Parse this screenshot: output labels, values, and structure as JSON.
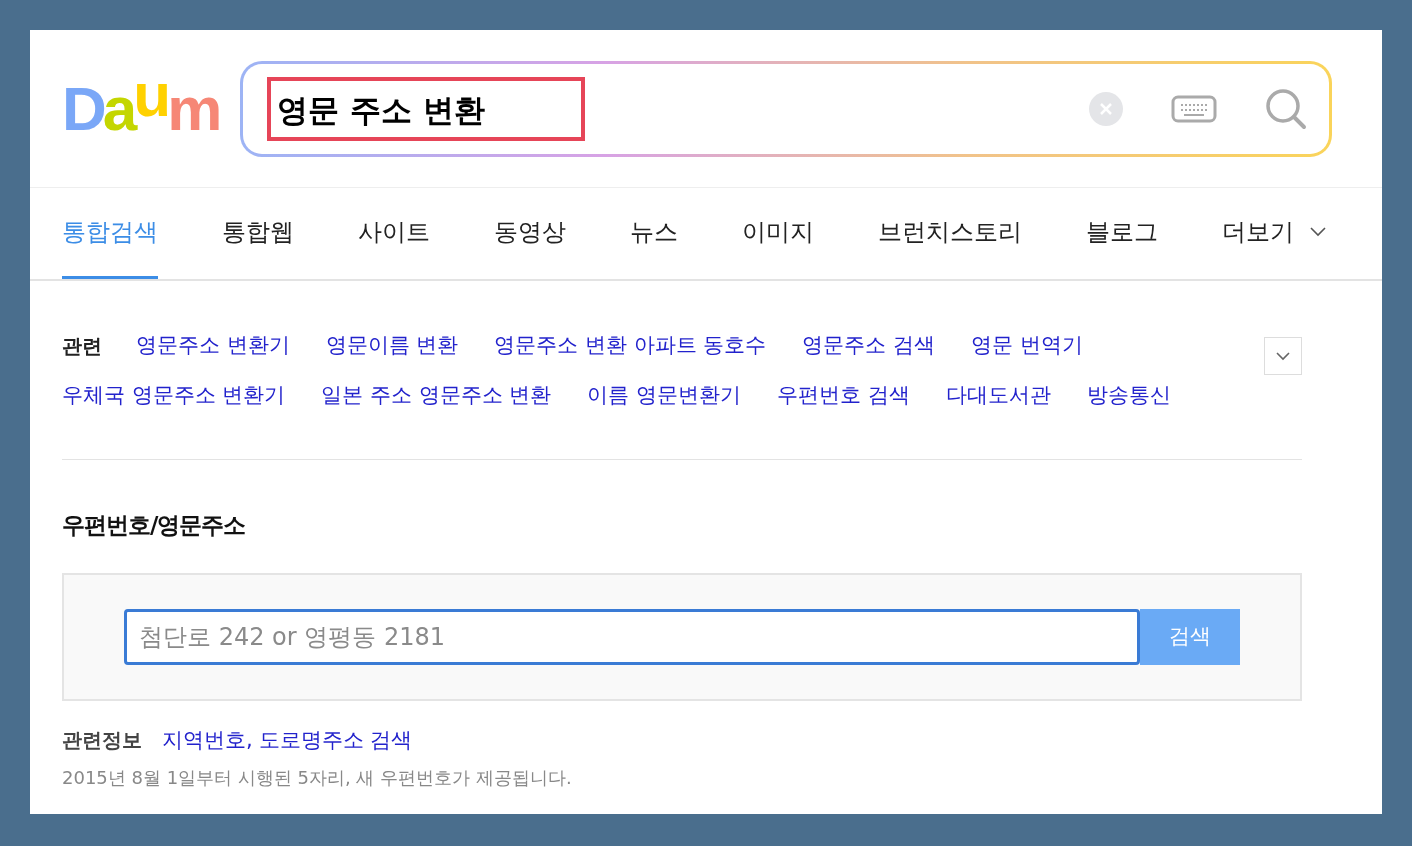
{
  "logo": {
    "text": "Daum"
  },
  "search": {
    "query": "영문 주소 변환",
    "highlighted": true
  },
  "tabs": [
    {
      "label": "통합검색",
      "selected": true
    },
    {
      "label": "통합웹",
      "selected": false
    },
    {
      "label": "사이트",
      "selected": false
    },
    {
      "label": "동영상",
      "selected": false
    },
    {
      "label": "뉴스",
      "selected": false
    },
    {
      "label": "이미지",
      "selected": false
    },
    {
      "label": "브런치스토리",
      "selected": false
    },
    {
      "label": "블로그",
      "selected": false
    },
    {
      "label": "더보기",
      "selected": false,
      "kind": "more"
    }
  ],
  "related": {
    "label": "관련",
    "rows": [
      [
        "영문주소 변환기",
        "영문이름 변환",
        "영문주소 변환 아파트 동호수",
        "영문주소 검색",
        "영문 번역기"
      ],
      [
        "우체국 영문주소 변환기",
        "일본 주소 영문주소 변환",
        "이름 영문변환기",
        "우편번호 검색",
        "다대도서관",
        "방송통신"
      ]
    ],
    "expanded": false
  },
  "postal": {
    "title": "우편번호/영문주소",
    "placeholder": "첨단로 242 or 영평동 2181",
    "button": "검색"
  },
  "related_info": {
    "label": "관련정보",
    "links": [
      "지역번호,",
      "도로명주소 검색"
    ],
    "note": "2015년 8월 1일부터 시행된 5자리, 새 우편번호가 제공됩니다."
  }
}
